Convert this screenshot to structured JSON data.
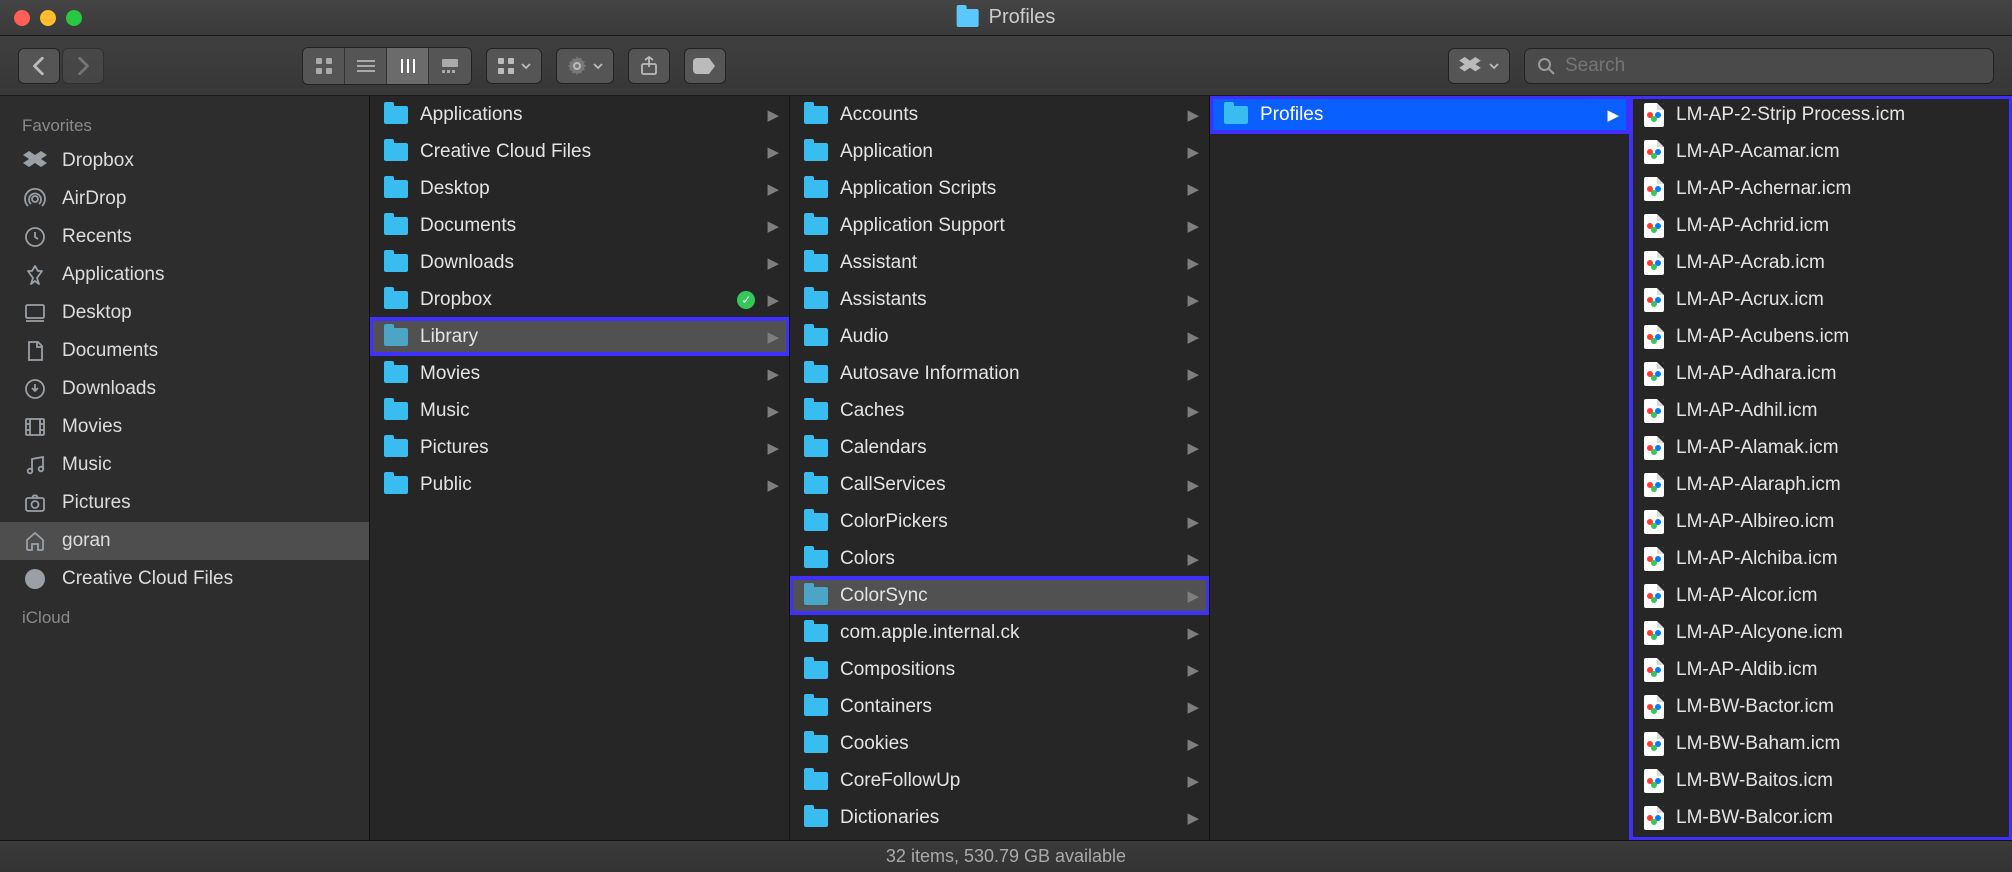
{
  "window": {
    "title": "Profiles"
  },
  "search": {
    "placeholder": "Search"
  },
  "sidebar": {
    "sections": [
      {
        "title": "Favorites",
        "items": [
          {
            "label": "Dropbox",
            "icon": "dropbox"
          },
          {
            "label": "AirDrop",
            "icon": "airdrop"
          },
          {
            "label": "Recents",
            "icon": "clock"
          },
          {
            "label": "Applications",
            "icon": "app"
          },
          {
            "label": "Desktop",
            "icon": "desktop"
          },
          {
            "label": "Documents",
            "icon": "doc"
          },
          {
            "label": "Downloads",
            "icon": "download"
          },
          {
            "label": "Movies",
            "icon": "movie"
          },
          {
            "label": "Music",
            "icon": "music"
          },
          {
            "label": "Pictures",
            "icon": "camera"
          },
          {
            "label": "goran",
            "icon": "home",
            "active": true
          },
          {
            "label": "Creative Cloud Files",
            "icon": "cc"
          }
        ]
      },
      {
        "title": "iCloud",
        "items": []
      }
    ]
  },
  "columns": [
    {
      "highlighted": false,
      "items": [
        {
          "label": "Applications",
          "type": "folder",
          "arrow": true
        },
        {
          "label": "Creative Cloud Files",
          "type": "folder",
          "arrow": true
        },
        {
          "label": "Desktop",
          "type": "folder",
          "arrow": true
        },
        {
          "label": "Documents",
          "type": "folder",
          "arrow": true
        },
        {
          "label": "Downloads",
          "type": "folder",
          "arrow": true
        },
        {
          "label": "Dropbox",
          "type": "folder",
          "arrow": true,
          "sync": true
        },
        {
          "label": "Library",
          "type": "folder",
          "arrow": true,
          "selected": "path",
          "outlined": true
        },
        {
          "label": "Movies",
          "type": "folder",
          "arrow": true
        },
        {
          "label": "Music",
          "type": "folder",
          "arrow": true
        },
        {
          "label": "Pictures",
          "type": "folder",
          "arrow": true
        },
        {
          "label": "Public",
          "type": "folder",
          "arrow": true
        }
      ]
    },
    {
      "highlighted": false,
      "items": [
        {
          "label": "Accounts",
          "type": "folder",
          "arrow": true
        },
        {
          "label": "Application",
          "type": "folder",
          "arrow": true
        },
        {
          "label": "Application Scripts",
          "type": "folder",
          "arrow": true
        },
        {
          "label": "Application Support",
          "type": "folder",
          "arrow": true
        },
        {
          "label": "Assistant",
          "type": "folder",
          "arrow": true
        },
        {
          "label": "Assistants",
          "type": "folder",
          "arrow": true
        },
        {
          "label": "Audio",
          "type": "folder",
          "arrow": true
        },
        {
          "label": "Autosave Information",
          "type": "folder",
          "arrow": true
        },
        {
          "label": "Caches",
          "type": "folder",
          "arrow": true
        },
        {
          "label": "Calendars",
          "type": "folder",
          "arrow": true
        },
        {
          "label": "CallServices",
          "type": "folder",
          "arrow": true
        },
        {
          "label": "ColorPickers",
          "type": "folder",
          "arrow": true
        },
        {
          "label": "Colors",
          "type": "folder",
          "arrow": true
        },
        {
          "label": "ColorSync",
          "type": "folder",
          "arrow": true,
          "selected": "path",
          "outlined": true
        },
        {
          "label": "com.apple.internal.ck",
          "type": "folder",
          "arrow": true
        },
        {
          "label": "Compositions",
          "type": "folder",
          "arrow": true
        },
        {
          "label": "Containers",
          "type": "folder",
          "arrow": true
        },
        {
          "label": "Cookies",
          "type": "folder",
          "arrow": true
        },
        {
          "label": "CoreFollowUp",
          "type": "folder",
          "arrow": true
        },
        {
          "label": "Dictionaries",
          "type": "folder",
          "arrow": true
        }
      ]
    },
    {
      "highlighted": false,
      "items": [
        {
          "label": "Profiles",
          "type": "folder",
          "arrow": true,
          "selected": "active",
          "outlined": true
        }
      ]
    },
    {
      "highlighted": true,
      "items": [
        {
          "label": "LM-AP-2-Strip Process.icm",
          "type": "file"
        },
        {
          "label": "LM-AP-Acamar.icm",
          "type": "file"
        },
        {
          "label": "LM-AP-Achernar.icm",
          "type": "file"
        },
        {
          "label": "LM-AP-Achrid.icm",
          "type": "file"
        },
        {
          "label": "LM-AP-Acrab.icm",
          "type": "file"
        },
        {
          "label": "LM-AP-Acrux.icm",
          "type": "file"
        },
        {
          "label": "LM-AP-Acubens.icm",
          "type": "file"
        },
        {
          "label": "LM-AP-Adhara.icm",
          "type": "file"
        },
        {
          "label": "LM-AP-Adhil.icm",
          "type": "file"
        },
        {
          "label": "LM-AP-Alamak.icm",
          "type": "file"
        },
        {
          "label": "LM-AP-Alaraph.icm",
          "type": "file"
        },
        {
          "label": "LM-AP-Albireo.icm",
          "type": "file"
        },
        {
          "label": "LM-AP-Alchiba.icm",
          "type": "file"
        },
        {
          "label": "LM-AP-Alcor.icm",
          "type": "file"
        },
        {
          "label": "LM-AP-Alcyone.icm",
          "type": "file"
        },
        {
          "label": "LM-AP-Aldib.icm",
          "type": "file"
        },
        {
          "label": "LM-BW-Bactor.icm",
          "type": "file"
        },
        {
          "label": "LM-BW-Baham.icm",
          "type": "file"
        },
        {
          "label": "LM-BW-Baitos.icm",
          "type": "file"
        },
        {
          "label": "LM-BW-Balcor.icm",
          "type": "file"
        }
      ]
    }
  ],
  "status": {
    "text": "32 items, 530.79 GB available"
  }
}
